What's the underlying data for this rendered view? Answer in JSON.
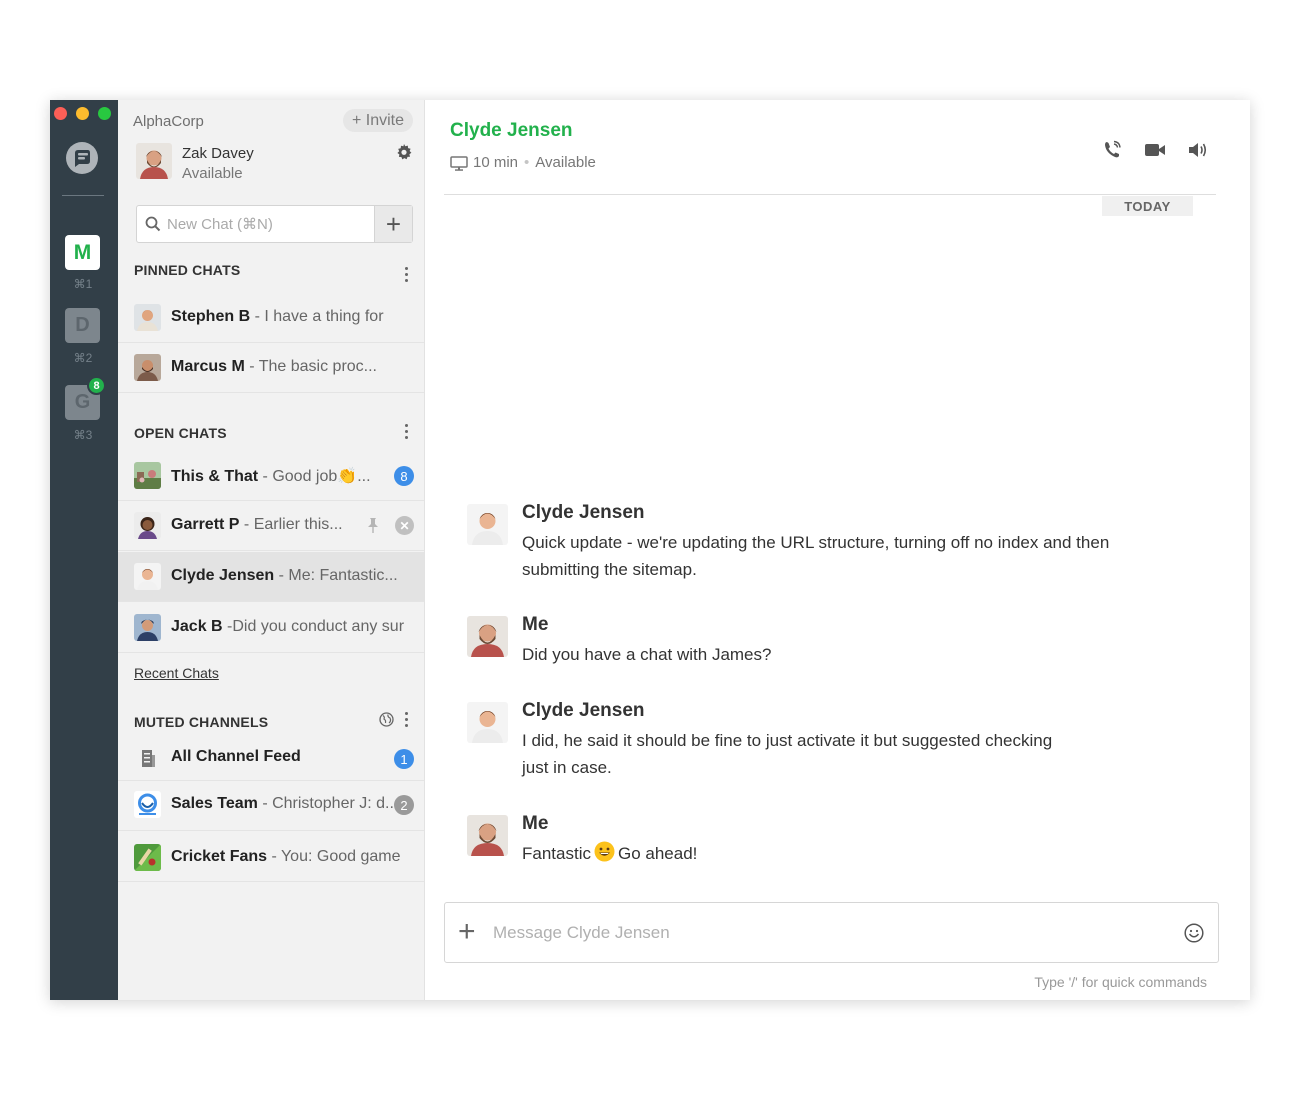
{
  "window": {
    "traffic_lights": [
      "#fc5f57",
      "#fdbc2e",
      "#28c840"
    ]
  },
  "rail": {
    "workspaces": [
      {
        "letter": "M",
        "shortcut": "⌘1",
        "active": true
      },
      {
        "letter": "D",
        "shortcut": "⌘2",
        "active": false
      },
      {
        "letter": "G",
        "shortcut": "⌘3",
        "active": false,
        "badge": "8"
      }
    ]
  },
  "sidebar": {
    "org_name": "AlphaCorp",
    "invite_label": "+ Invite",
    "user": {
      "name": "Zak Davey",
      "status": "Available"
    },
    "search": {
      "placeholder": "New Chat (⌘N)",
      "add_label": "+"
    },
    "pinned": {
      "header": "PINNED CHATS",
      "items": [
        {
          "name": "Stephen B",
          "preview": " - I have a thing for"
        },
        {
          "name": "Marcus M",
          "preview": " - The basic proc..."
        }
      ]
    },
    "open": {
      "header": "OPEN CHATS",
      "items": [
        {
          "name": "This & That",
          "preview": " - Good job👏...",
          "badge": "8"
        },
        {
          "name": "Garrett P",
          "preview": " - Earlier this...",
          "pinned": true
        },
        {
          "name": "Clyde Jensen",
          "preview": " - Me: Fantastic...",
          "active": true
        },
        {
          "name": "Jack B",
          "preview": " -Did you conduct any sur"
        }
      ]
    },
    "recent_link": "Recent Chats",
    "muted": {
      "header": "MUTED CHANNELS",
      "items": [
        {
          "name": "All Channel Feed",
          "preview": "",
          "badge": "1"
        },
        {
          "name": "Sales Team",
          "preview": " - Christopher J: d...",
          "badge": "2"
        },
        {
          "name": "Cricket Fans",
          "preview": " - You: Good game"
        }
      ]
    }
  },
  "chat": {
    "peer": {
      "name": "Clyde Jensen",
      "idle": "10 min",
      "status": "Available"
    },
    "date_divider": "TODAY",
    "messages": [
      {
        "author": "Clyde Jensen",
        "text": "Quick update -  we're updating the URL structure, turning off no index and then submitting the sitemap."
      },
      {
        "author": "Me",
        "text": "Did you have a chat with James?"
      },
      {
        "author": "Clyde Jensen",
        "text": "I did, he said it should be fine to just activate it but suggested checking just in case."
      },
      {
        "author": "Me",
        "text_before": "Fantastic",
        "emoji": "grinning-face",
        "text_after": "Go ahead!"
      }
    ],
    "composer": {
      "placeholder": "Message Clyde Jensen",
      "hint": "Type '/' for quick commands"
    }
  },
  "colors": {
    "rail_bg": "#323f48",
    "sidebar_bg": "#f2f2f2",
    "accent_green": "#22b14c",
    "badge_blue": "#3d8ee8"
  },
  "icons": [
    "chat-logo-icon",
    "gear-icon",
    "search-icon",
    "pin-icon",
    "close-icon",
    "globe-icon",
    "monitor-icon",
    "phone-icon",
    "video-icon",
    "speaker-icon",
    "plus-icon",
    "smiley-icon"
  ]
}
